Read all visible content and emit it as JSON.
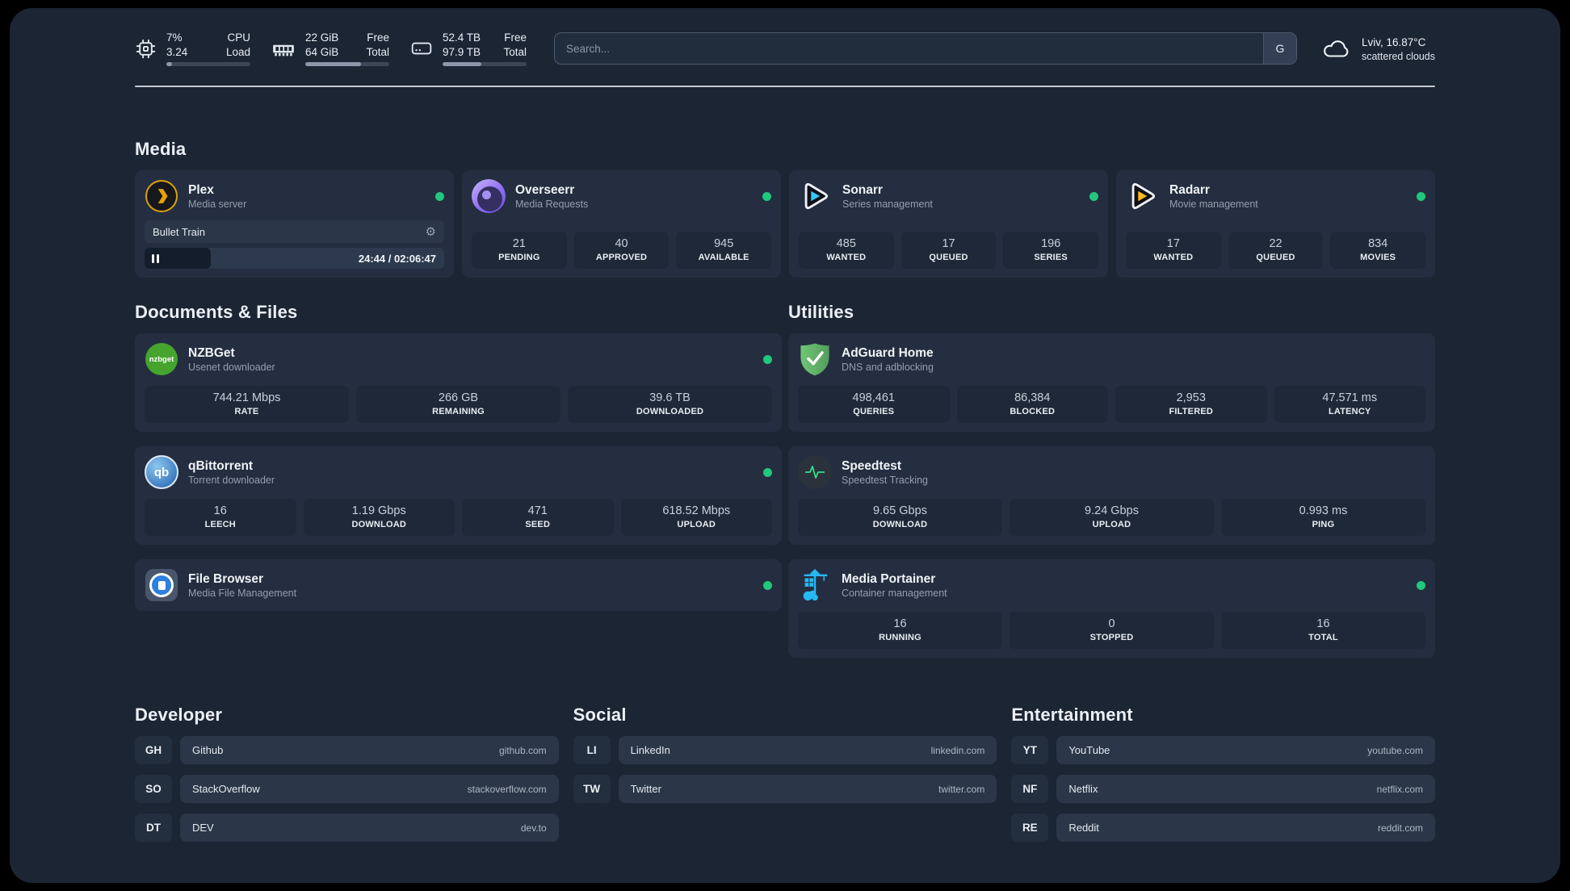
{
  "topbar": {
    "resources": [
      {
        "a1": "7%",
        "a2": "3.24",
        "b1": "CPU",
        "b2": "Load",
        "progress": 7
      },
      {
        "a1": "22 GiB",
        "a2": "64 GiB",
        "b1": "Free",
        "b2": "Total",
        "progress": 66
      },
      {
        "a1": "52.4 TB",
        "a2": "97.9 TB",
        "b1": "Free",
        "b2": "Total",
        "progress": 46
      }
    ],
    "search": {
      "placeholder": "Search...",
      "button": "G"
    },
    "weather": {
      "line1": "Lviv, 16.87°C",
      "line2": "scattered clouds"
    }
  },
  "media": {
    "title": "Media",
    "plex": {
      "name": "Plex",
      "desc": "Media server",
      "now_playing": "Bullet Train",
      "time": "24:44 / 02:06:47",
      "progress_pct": 19.6
    },
    "overseerr": {
      "name": "Overseerr",
      "desc": "Media Requests",
      "stats": [
        {
          "value": "21",
          "label": "PENDING"
        },
        {
          "value": "40",
          "label": "APPROVED"
        },
        {
          "value": "945",
          "label": "AVAILABLE"
        }
      ]
    },
    "sonarr": {
      "name": "Sonarr",
      "desc": "Series management",
      "stats": [
        {
          "value": "485",
          "label": "WANTED"
        },
        {
          "value": "17",
          "label": "QUEUED"
        },
        {
          "value": "196",
          "label": "SERIES"
        }
      ]
    },
    "radarr": {
      "name": "Radarr",
      "desc": "Movie management",
      "stats": [
        {
          "value": "17",
          "label": "WANTED"
        },
        {
          "value": "22",
          "label": "QUEUED"
        },
        {
          "value": "834",
          "label": "MOVIES"
        }
      ]
    }
  },
  "documents": {
    "title": "Documents & Files",
    "nzbget": {
      "name": "NZBGet",
      "desc": "Usenet downloader",
      "icon_text": "nzbget",
      "stats": [
        {
          "value": "744.21 Mbps",
          "label": "RATE"
        },
        {
          "value": "266 GB",
          "label": "REMAINING"
        },
        {
          "value": "39.6 TB",
          "label": "DOWNLOADED"
        }
      ]
    },
    "qbittorrent": {
      "name": "qBittorrent",
      "desc": "Torrent downloader",
      "icon_text": "qb",
      "stats": [
        {
          "value": "16",
          "label": "LEECH"
        },
        {
          "value": "1.19 Gbps",
          "label": "DOWNLOAD"
        },
        {
          "value": "471",
          "label": "SEED"
        },
        {
          "value": "618.52 Mbps",
          "label": "UPLOAD"
        }
      ]
    },
    "filebrowser": {
      "name": "File Browser",
      "desc": "Media File Management"
    }
  },
  "utilities": {
    "title": "Utilities",
    "adguard": {
      "name": "AdGuard Home",
      "desc": "DNS and adblocking",
      "stats": [
        {
          "value": "498,461",
          "label": "QUERIES"
        },
        {
          "value": "86,384",
          "label": "BLOCKED"
        },
        {
          "value": "2,953",
          "label": "FILTERED"
        },
        {
          "value": "47.571 ms",
          "label": "LATENCY"
        }
      ]
    },
    "speedtest": {
      "name": "Speedtest",
      "desc": "Speedtest Tracking",
      "stats": [
        {
          "value": "9.65 Gbps",
          "label": "DOWNLOAD"
        },
        {
          "value": "9.24 Gbps",
          "label": "UPLOAD"
        },
        {
          "value": "0.993 ms",
          "label": "PING"
        }
      ]
    },
    "portainer": {
      "name": "Media Portainer",
      "desc": "Container management",
      "stats": [
        {
          "value": "16",
          "label": "RUNNING"
        },
        {
          "value": "0",
          "label": "STOPPED"
        },
        {
          "value": "16",
          "label": "TOTAL"
        }
      ]
    }
  },
  "bookmarks": [
    {
      "title": "Developer",
      "items": [
        {
          "abbr": "GH",
          "name": "Github",
          "domain": "github.com"
        },
        {
          "abbr": "SO",
          "name": "StackOverflow",
          "domain": "stackoverflow.com"
        },
        {
          "abbr": "DT",
          "name": "DEV",
          "domain": "dev.to"
        }
      ]
    },
    {
      "title": "Social",
      "items": [
        {
          "abbr": "LI",
          "name": "LinkedIn",
          "domain": "linkedin.com"
        },
        {
          "abbr": "TW",
          "name": "Twitter",
          "domain": "twitter.com"
        }
      ]
    },
    {
      "title": "Entertainment",
      "items": [
        {
          "abbr": "YT",
          "name": "YouTube",
          "domain": "youtube.com"
        },
        {
          "abbr": "NF",
          "name": "Netflix",
          "domain": "netflix.com"
        },
        {
          "abbr": "RE",
          "name": "Reddit",
          "domain": "reddit.com"
        }
      ]
    }
  ],
  "colors": {
    "status_online": "#21c77d",
    "plex_accent": "#e8a00d",
    "sonarr_accent": "#36c6f4",
    "radarr_accent": "#ffb81f",
    "portainer_accent": "#27b9f5"
  }
}
